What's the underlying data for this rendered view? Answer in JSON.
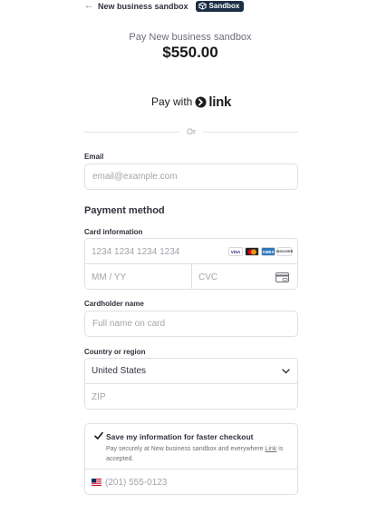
{
  "header": {
    "back_arrow": "←",
    "business_name": "New business sandbox",
    "badge": "Sandbox"
  },
  "summary": {
    "pay_label": "Pay New business sandbox",
    "amount": "$550.00"
  },
  "link_button": {
    "prefix": "Pay with",
    "brand": "link"
  },
  "divider_text": "Or",
  "email": {
    "label": "Email",
    "placeholder": "email@example.com"
  },
  "payment": {
    "section_title": "Payment method",
    "card_label": "Card information",
    "card_number_placeholder": "1234 1234 1234 1234",
    "expiry_placeholder": "MM / YY",
    "cvc_placeholder": "CVC",
    "brand_icons": [
      "visa-icon",
      "mastercard-icon",
      "amex-icon",
      "discover-icon"
    ],
    "brand_visa": "VISA",
    "brand_amex": "AMEX",
    "brand_discover": "DISCOVER",
    "cardholder_label": "Cardholder name",
    "cardholder_placeholder": "Full name on card",
    "country_label": "Country or region",
    "country_value": "United States",
    "zip_placeholder": "ZIP"
  },
  "save_info": {
    "checked": true,
    "title": "Save my information for faster checkout",
    "desc_before": "Pay securely at New business sandbox and everywhere ",
    "desc_link": "Link",
    "desc_after": " is accepted.",
    "phone_placeholder": "(201) 555-0123"
  },
  "colors": {
    "badge_bg": "#1a2e45",
    "text": "#30313d",
    "muted": "#6d6e78",
    "border": "#e0e0e4",
    "checkmark": "#1a1a1a"
  }
}
